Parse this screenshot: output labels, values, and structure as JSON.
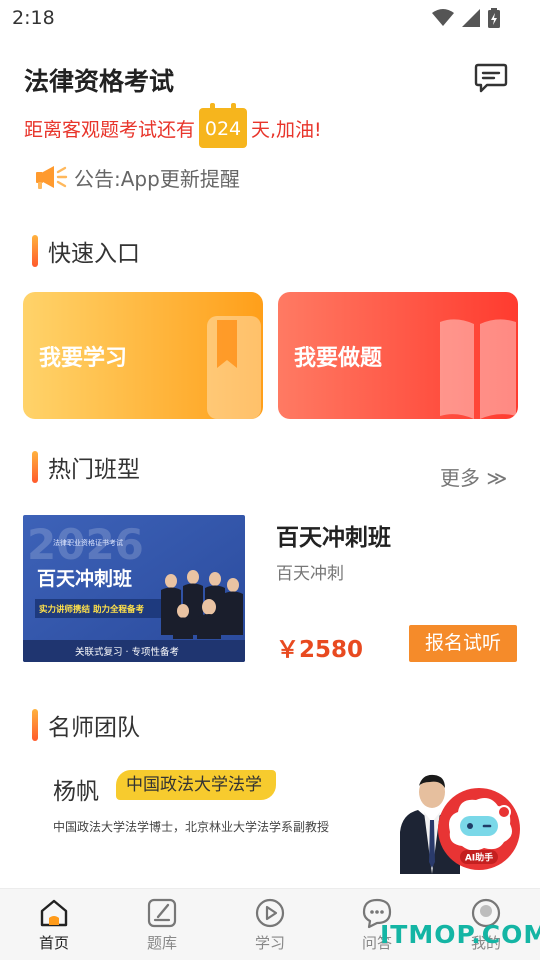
{
  "status": {
    "time": "2:18"
  },
  "header": {
    "title": "法律资格考试",
    "countdown_prefix": "距离客观题考试还有",
    "countdown_days": "024",
    "countdown_suffix": "天,加油!",
    "notice_prefix": "公告:",
    "notice_text": "App更新提醒"
  },
  "quick_entry": {
    "title": "快速入口",
    "items": [
      {
        "label": "我要学习"
      },
      {
        "label": "我要做题"
      }
    ]
  },
  "courses": {
    "title": "热门班型",
    "more_label": "更多 ≫",
    "items": [
      {
        "name": "百天冲刺班",
        "subtitle": "百天冲刺",
        "price": "￥2580",
        "button_label": "报名试听",
        "image": {
          "year": "2026",
          "exam_line": "法律职业资格证书考试",
          "headline": "百天冲刺班",
          "ribbon": "实力讲师携结 助力全程备考",
          "footer": "关联式复习 · 专项性备考"
        }
      }
    ]
  },
  "teachers": {
    "title": "名师团队",
    "items": [
      {
        "name": "杨帆",
        "school": "中国政法大学法学",
        "description": "中国政法大学法学博士，北京林业大学法学系副教授"
      }
    ],
    "ai_label": "AI助手"
  },
  "bottom_nav": {
    "items": [
      {
        "label": "首页",
        "active": true
      },
      {
        "label": "题库",
        "active": false
      },
      {
        "label": "学习",
        "active": false
      },
      {
        "label": "问答",
        "active": false
      },
      {
        "label": "我的",
        "active": false
      }
    ]
  },
  "watermark": "ITMOP.COM",
  "colors": {
    "accent_orange": "#f58b2a",
    "countdown_red": "#e8352b",
    "price_red": "#e84a20",
    "badge_yellow": "#f7cb2e"
  }
}
